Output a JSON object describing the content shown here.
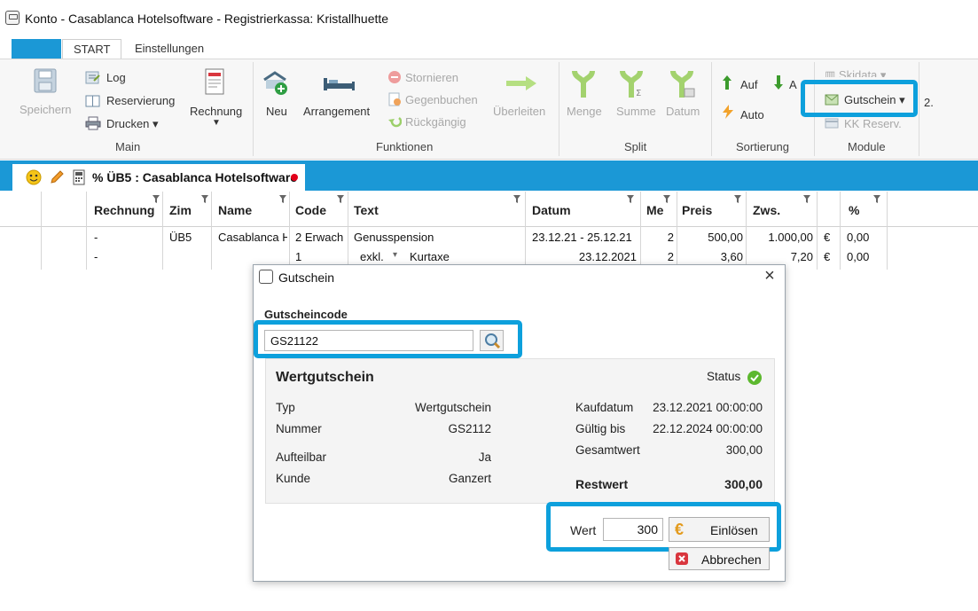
{
  "window": {
    "title": "Konto - Casablanca Hotelsoftware - Registrierkassa: Kristallhuette"
  },
  "ribbon": {
    "tabs": [
      "START",
      "Einstellungen"
    ],
    "groups": {
      "main": {
        "label": "Main",
        "speichern": "Speichern",
        "log": "Log",
        "reservierung": "Reservierung",
        "drucken": "Drucken",
        "rechnung": "Rechnung"
      },
      "funktionen": {
        "label": "Funktionen",
        "neu": "Neu",
        "arrangement": "Arrangement",
        "stornieren": "Stornieren",
        "gegenbuchen": "Gegenbuchen",
        "rueckgaengig": "Rückgängig",
        "ueberleiten": "Überleiten"
      },
      "split": {
        "label": "Split",
        "menge": "Menge",
        "summe": "Summe",
        "datum": "Datum"
      },
      "sortierung": {
        "label": "Sortierung",
        "auf": "Auf",
        "ab": "A",
        "auto": "Auto"
      },
      "module": {
        "label": "Module",
        "skidata": "Skidata",
        "gutschein": "Gutschein",
        "kk_reserv": "KK Reserv.",
        "overflow": "2."
      }
    }
  },
  "doc_tab": {
    "title": "% ÜB5 : Casablanca Hotelsoftware"
  },
  "grid": {
    "headers": [
      "Rechnung",
      "Zim",
      "Name",
      "Code",
      "Text",
      "Datum",
      "Me",
      "Preis",
      "Zws.",
      "%"
    ],
    "rows": [
      {
        "rechnung": "-",
        "zim": "ÜB5",
        "name": "Casablanca H",
        "code": "2 Erwach",
        "text": "Genusspension",
        "datum": "23.12.21 - 25.12.21",
        "me": "2",
        "preis": "500,00",
        "zws": "1.000,00",
        "currency": "€",
        "pct": "0,00"
      },
      {
        "rechnung": "-",
        "zim": "",
        "name": "",
        "code": "1",
        "text_prefix": "exkl.",
        "text": "Kurtaxe",
        "datum": "23.12.2021",
        "me": "2",
        "preis": "3,60",
        "zws": "7,20",
        "currency": "€",
        "pct": "0,00"
      }
    ]
  },
  "dialog": {
    "title": "Gutschein",
    "code_label": "Gutscheincode",
    "code_value": "GS21122",
    "card": {
      "title": "Wertgutschein",
      "status_label": "Status",
      "left": [
        {
          "k": "Typ",
          "v": "Wertgutschein"
        },
        {
          "k": "Nummer",
          "v": "GS2112"
        },
        {
          "k": "Aufteilbar",
          "v": "Ja"
        },
        {
          "k": "Kunde",
          "v": "Ganzert"
        }
      ],
      "right": [
        {
          "k": "Kaufdatum",
          "v": "23.12.2021 00:00:00"
        },
        {
          "k": "Gültig bis",
          "v": "22.12.2024 00:00:00"
        },
        {
          "k": "Gesamtwert",
          "v": "300,00"
        },
        {
          "k": "Restwert",
          "v": "300,00"
        }
      ]
    },
    "wert_label": "Wert",
    "wert_value": "300",
    "einloesen": "Einlösen",
    "abbrechen": "Abbrechen"
  },
  "colors": {
    "accent": "#1b98d6",
    "highlight": "#0da0dc",
    "status_ok": "#5cb82e"
  }
}
